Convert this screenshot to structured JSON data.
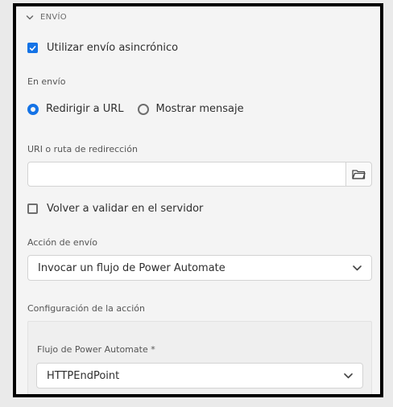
{
  "section": {
    "title": "ENVÍO"
  },
  "async_submit": {
    "label": "Utilizar envío asincrónico",
    "checked": true
  },
  "on_submit": {
    "label": "En envío",
    "options": [
      {
        "label": "Redirigir a URL",
        "selected": true
      },
      {
        "label": "Mostrar mensaje",
        "selected": false
      }
    ]
  },
  "redirect": {
    "label": "URI o ruta de redirección",
    "value": "",
    "placeholder": ""
  },
  "revalidate": {
    "label": "Volver a validar en el servidor",
    "checked": false
  },
  "submit_action": {
    "label": "Acción de envío",
    "value": "Invocar un flujo de Power Automate"
  },
  "action_config": {
    "label": "Configuración de la acción",
    "flow_label": "Flujo de Power Automate *",
    "flow_value": "HTTPEndPoint"
  },
  "colors": {
    "accent": "#1473e6",
    "frame": "#000000",
    "panel": "#f4f4f4"
  },
  "icons": {
    "section_toggle": "chevron-down-icon",
    "browse": "folder-icon",
    "dropdown": "chevron-down-icon"
  }
}
